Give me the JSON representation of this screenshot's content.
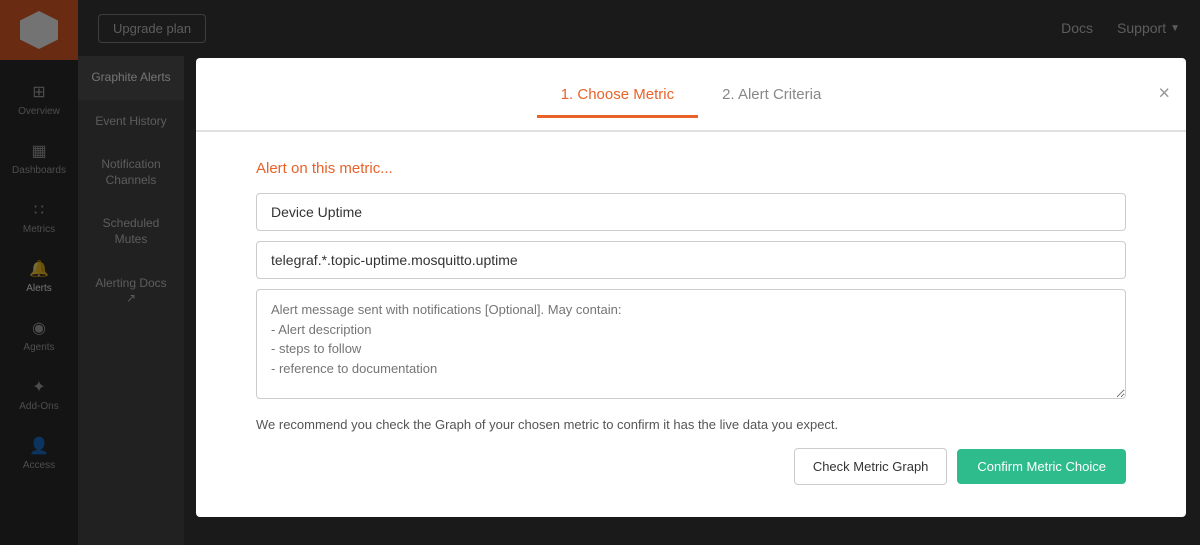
{
  "sidebar": {
    "logo_alt": "Hoopla logo",
    "items": [
      {
        "id": "overview",
        "label": "Overview",
        "icon": "⊞"
      },
      {
        "id": "dashboards",
        "label": "Dashboards",
        "icon": "▦"
      },
      {
        "id": "metrics",
        "label": "Metrics",
        "icon": "∷"
      },
      {
        "id": "alerts",
        "label": "Alerts",
        "icon": "🔔",
        "active": true
      },
      {
        "id": "agents",
        "label": "Agents",
        "icon": "◉"
      },
      {
        "id": "add-ons",
        "label": "Add-Ons",
        "icon": "✦"
      },
      {
        "id": "access",
        "label": "Access",
        "icon": "👤"
      }
    ]
  },
  "topnav": {
    "upgrade_label": "Upgrade plan",
    "docs_label": "Docs",
    "support_label": "Support"
  },
  "secondary_sidebar": {
    "items": [
      {
        "id": "graphite-alerts",
        "label": "Graphite Alerts",
        "active": true
      },
      {
        "id": "event-history",
        "label": "Event History"
      },
      {
        "id": "notification-channels",
        "label": "Notification Channels"
      },
      {
        "id": "scheduled-mutes",
        "label": "Scheduled Mutes"
      },
      {
        "id": "alerting-docs",
        "label": "Alerting Docs ↗"
      }
    ]
  },
  "modal": {
    "tab1_label": "1. Choose Metric",
    "tab2_label": "2. Alert Criteria",
    "close_label": "×",
    "section_label": "Alert on this metric...",
    "metric_name_value": "Device Uptime",
    "metric_name_placeholder": "Device Uptime",
    "metric_path_value": "telegraf.*.topic-uptime.mosquitto.uptime",
    "metric_path_placeholder": "telegraf.*.topic-uptime.mosquitto.uptime",
    "message_placeholder": "Alert message sent with notifications [Optional]. May contain:\n- Alert description\n- steps to follow\n- reference to documentation",
    "recommend_text": "We recommend you check the Graph of your chosen metric to confirm it has the live data you expect.",
    "btn_check_label": "Check Metric Graph",
    "btn_confirm_label": "Confirm Metric Choice"
  },
  "colors": {
    "accent": "#e8622a",
    "primary_green": "#2ebc8c",
    "sidebar_bg": "#2d2d2d",
    "secondary_sidebar_bg": "#4a4a4a"
  }
}
